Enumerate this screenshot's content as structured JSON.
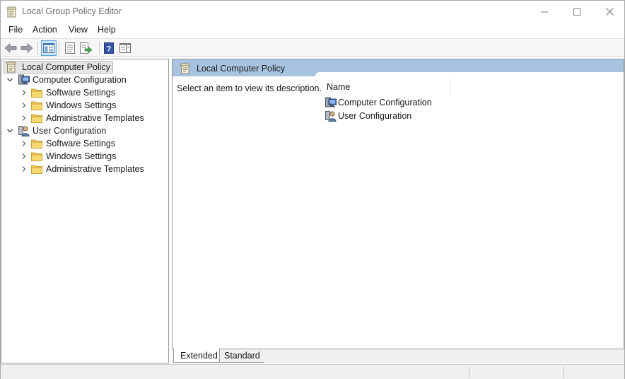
{
  "window": {
    "title": "Local Group Policy Editor",
    "controls": [
      "minimize",
      "maximize",
      "close"
    ]
  },
  "menu": [
    {
      "label": "File"
    },
    {
      "label": "Action"
    },
    {
      "label": "View"
    },
    {
      "label": "Help"
    }
  ],
  "toolbar": {
    "buttons": [
      "back-arrow-icon",
      "forward-arrow-icon",
      "show-hide-console-tree-icon",
      "properties-icon",
      "export-list-icon",
      "help-icon",
      "show-hide-action-pane-icon"
    ]
  },
  "tree": {
    "root": "Local Computer Policy",
    "computer": {
      "label": "Computer Configuration",
      "children": [
        {
          "label": "Software Settings"
        },
        {
          "label": "Windows Settings"
        },
        {
          "label": "Administrative Templates"
        }
      ]
    },
    "user": {
      "label": "User Configuration",
      "children": [
        {
          "label": "Software Settings"
        },
        {
          "label": "Windows Settings"
        },
        {
          "label": "Administrative Templates"
        }
      ]
    }
  },
  "details": {
    "header": "Local Computer Policy",
    "description": "Select an item to view its description.",
    "column_name": "Name",
    "items": [
      {
        "label": "Computer Configuration"
      },
      {
        "label": "User Configuration"
      }
    ]
  },
  "tabs": {
    "extended": "Extended",
    "standard": "Standard",
    "selected": "Extended"
  },
  "colors": {
    "header_band": "#a8c3e0",
    "folder": "#f3cd5c",
    "selection": "#e5e5e5"
  }
}
